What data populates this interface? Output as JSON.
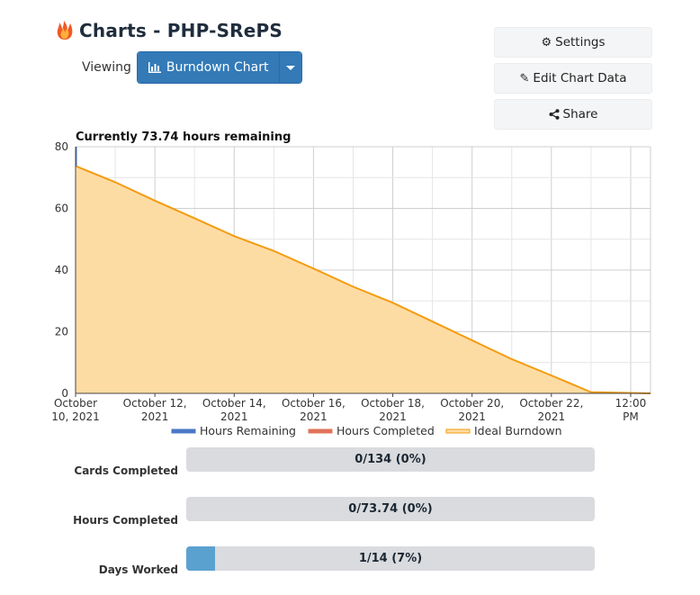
{
  "header": {
    "title": "Charts - PHP-SRePS",
    "viewing_label": "Viewing",
    "view_button_label": "Burndown Chart"
  },
  "actions": {
    "settings_label": "Settings",
    "edit_label": "Edit Chart Data",
    "share_label": "Share"
  },
  "chart_data": {
    "type": "area",
    "title": "Currently 73.74 hours remaining",
    "ylim": [
      0,
      80
    ],
    "y_ticks": [
      "0",
      "20",
      "40",
      "60",
      "80"
    ],
    "x_ticks": [
      {
        "line1": "October",
        "line2": "10, 2021"
      },
      {
        "line1": "October 12,",
        "line2": "2021"
      },
      {
        "line1": "October 14,",
        "line2": "2021"
      },
      {
        "line1": "October 16,",
        "line2": "2021"
      },
      {
        "line1": "October 18,",
        "line2": "2021"
      },
      {
        "line1": "October 20,",
        "line2": "2021"
      },
      {
        "line1": "October 22,",
        "line2": "2021"
      },
      {
        "line1": "12:00",
        "line2": "PM"
      }
    ],
    "series": [
      {
        "name": "Hours Remaining",
        "color": "#4a78c6",
        "x": [
          "2021-10-10"
        ],
        "values": [
          80
        ]
      },
      {
        "name": "Hours Completed",
        "color": "#e0735a",
        "x": [],
        "values": []
      },
      {
        "name": "Ideal Burndown",
        "color": "#f39c12",
        "fill": "#fddca4",
        "x": [
          "2021-10-10",
          "2021-10-11",
          "2021-10-12",
          "2021-10-13",
          "2021-10-14",
          "2021-10-15",
          "2021-10-16",
          "2021-10-17",
          "2021-10-18",
          "2021-10-19",
          "2021-10-20",
          "2021-10-21",
          "2021-10-22",
          "2021-10-23",
          "2021-10-24"
        ],
        "values": [
          73.74,
          68.5,
          62.5,
          56.8,
          51.0,
          46.2,
          40.5,
          34.6,
          29.4,
          23.3,
          17.2,
          11.1,
          5.8,
          0.4,
          0
        ]
      }
    ],
    "legend": [
      "Hours Remaining",
      "Hours Completed",
      "Ideal Burndown"
    ],
    "grid": true,
    "legend_position": "bottom"
  },
  "stats": {
    "cards_label": "Cards Completed",
    "cards_value": "0/134 (0%)",
    "cards_fraction": 0,
    "hours_label": "Hours Completed",
    "hours_value": "0/73.74 (0%)",
    "hours_fraction": 0,
    "days_label": "Days Worked",
    "days_value": "1/14 (7%)",
    "days_fraction": 0.07
  }
}
